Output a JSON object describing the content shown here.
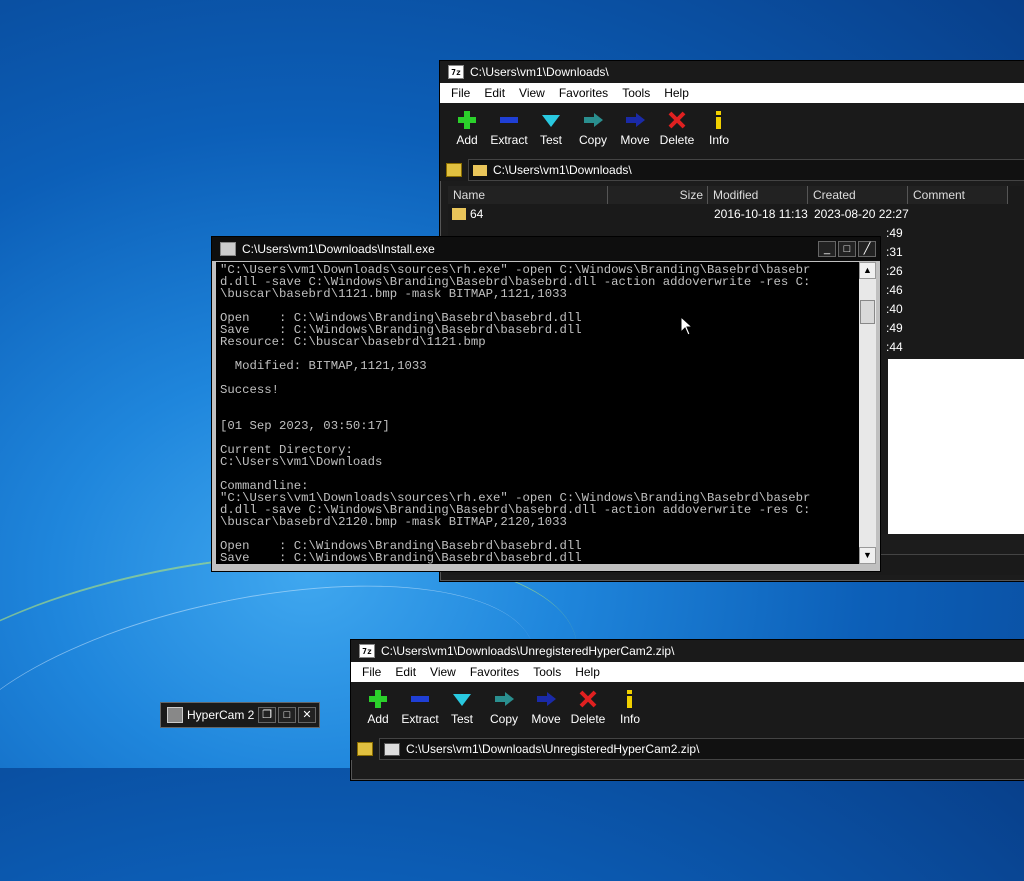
{
  "explorer_top": {
    "title": "C:\\Users\\vm1\\Downloads\\",
    "menu": [
      "File",
      "Edit",
      "View",
      "Favorites",
      "Tools",
      "Help"
    ],
    "toolbar": [
      "Add",
      "Extract",
      "Test",
      "Copy",
      "Move",
      "Delete",
      "Info"
    ],
    "address": "C:\\Users\\vm1\\Downloads\\",
    "columns": [
      "Name",
      "Size",
      "Modified",
      "Created",
      "Comment"
    ],
    "rows": [
      {
        "name": "64",
        "size": "",
        "modified": "2016-10-18 11:13",
        "created": "2023-08-20 22:27"
      }
    ],
    "hidden_times": [
      ":49",
      ":31",
      ":26",
      ":46",
      ":40",
      ":49",
      ":44"
    ]
  },
  "console": {
    "title": "C:\\Users\\vm1\\Downloads\\Install.exe",
    "output": "\"C:\\Users\\vm1\\Downloads\\sources\\rh.exe\" -open C:\\Windows\\Branding\\Basebrd\\basebr\nd.dll -save C:\\Windows\\Branding\\Basebrd\\basebrd.dll -action addoverwrite -res C:\n\\buscar\\basebrd\\1121.bmp -mask BITMAP,1121,1033\n\nOpen    : C:\\Windows\\Branding\\Basebrd\\basebrd.dll\nSave    : C:\\Windows\\Branding\\Basebrd\\basebrd.dll\nResource: C:\\buscar\\basebrd\\1121.bmp\n\n  Modified: BITMAP,1121,1033\n\nSuccess!\n\n\n[01 Sep 2023, 03:50:17]\n\nCurrent Directory:\nC:\\Users\\vm1\\Downloads\n\nCommandline:\n\"C:\\Users\\vm1\\Downloads\\sources\\rh.exe\" -open C:\\Windows\\Branding\\Basebrd\\basebr\nd.dll -save C:\\Windows\\Branding\\Basebrd\\basebrd.dll -action addoverwrite -res C:\n\\buscar\\basebrd\\2120.bmp -mask BITMAP,2120,1033\n\nOpen    : C:\\Windows\\Branding\\Basebrd\\basebrd.dll\nSave    : C:\\Windows\\Branding\\Basebrd\\basebrd.dll"
  },
  "explorer_bottom": {
    "title": "C:\\Users\\vm1\\Downloads\\UnregisteredHyperCam2.zip\\",
    "menu": [
      "File",
      "Edit",
      "View",
      "Favorites",
      "Tools",
      "Help"
    ],
    "toolbar": [
      "Add",
      "Extract",
      "Test",
      "Copy",
      "Move",
      "Delete",
      "Info"
    ],
    "address": "C:\\Users\\vm1\\Downloads\\UnregisteredHyperCam2.zip\\"
  },
  "hypercam": {
    "title": "HyperCam 2"
  },
  "icons": {
    "add": "plus-icon",
    "extract": "minus-icon",
    "test": "check-icon",
    "copy": "copy-arrow-icon",
    "move": "move-arrow-icon",
    "delete": "x-icon",
    "info": "info-icon"
  },
  "colors": {
    "add": "#2bd12b",
    "extract": "#1f3fd6",
    "test": "#29c9e0",
    "copy": "#2a8f8f",
    "move": "#1a2aa8",
    "delete": "#e02020",
    "info": "#f0d000"
  }
}
